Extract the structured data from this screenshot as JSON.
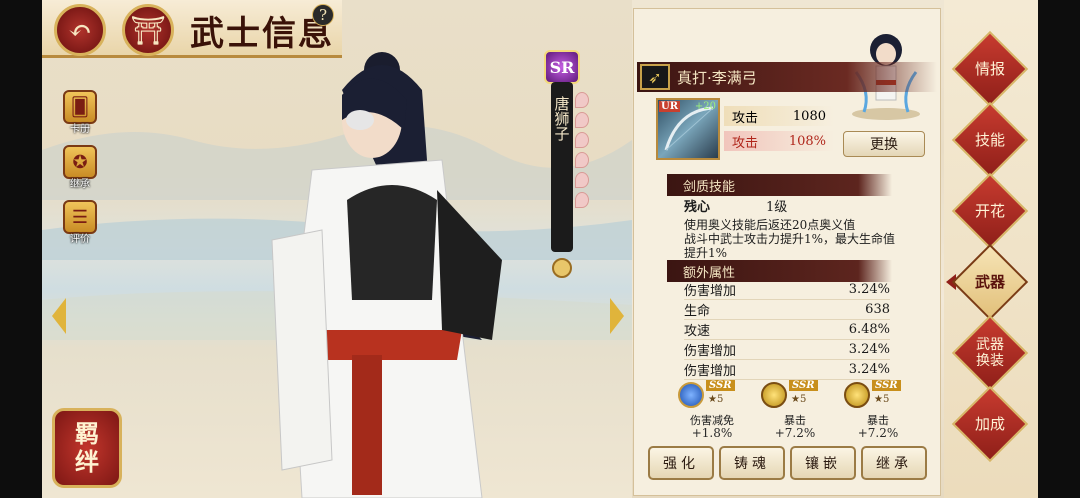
{
  "header": {
    "title": "武士信息",
    "back_label": "↶",
    "home_label": "⛩",
    "help_label": "?"
  },
  "left_menu": [
    {
      "label": "卡册",
      "icon": "card-album-icon",
      "glyph": "🂠"
    },
    {
      "label": "继承",
      "icon": "inherit-star-icon",
      "glyph": "✪"
    },
    {
      "label": "评价",
      "icon": "review-icon",
      "glyph": "☰"
    }
  ],
  "bond_button": {
    "line1": "羁",
    "line2": "绊"
  },
  "character": {
    "rarity": "SR",
    "name": "唐狮子"
  },
  "weapon": {
    "name": "真打·李满弓",
    "card_rarity": "UR",
    "card_level": "+20",
    "stats": [
      {
        "label": "攻击",
        "value": "1080"
      },
      {
        "label": "攻击",
        "value": "108%"
      }
    ],
    "swap_label": "更换"
  },
  "skill_section": {
    "title": "剑质技能",
    "skill_name": "残心",
    "skill_level": "1级",
    "desc_lines": [
      "使用奥义技能后返还20点奥义值",
      "战斗中武士攻击力提升1%，最大生命值",
      "提升1%"
    ]
  },
  "extra_section": {
    "title": "额外属性",
    "rows": [
      {
        "label": "伤害增加",
        "value": "3.24%"
      },
      {
        "label": "生命",
        "value": "638"
      },
      {
        "label": "攻速",
        "value": "6.48%"
      },
      {
        "label": "伤害增加",
        "value": "3.24%"
      },
      {
        "label": "伤害增加",
        "value": "3.24%"
      }
    ]
  },
  "gems": [
    {
      "rarity": "SSR",
      "stars": "5",
      "name": "伤害减免",
      "value": "+1.8%",
      "color": "#2b6fd1"
    },
    {
      "rarity": "SSR",
      "stars": "5",
      "name": "暴击",
      "value": "+7.2%",
      "color": "#e0b21f"
    },
    {
      "rarity": "SSR",
      "stars": "5",
      "name": "暴击",
      "value": "+7.2%",
      "color": "#e0b21f"
    }
  ],
  "bottom_buttons": [
    "强化",
    "铸魂",
    "镶嵌",
    "继承"
  ],
  "right_tabs": [
    {
      "label": "情报",
      "active": false
    },
    {
      "label": "技能",
      "active": false
    },
    {
      "label": "开花",
      "active": false
    },
    {
      "label": "武器",
      "active": true
    },
    {
      "label": "武器换装",
      "active": false
    },
    {
      "label": "加成",
      "active": false
    }
  ]
}
